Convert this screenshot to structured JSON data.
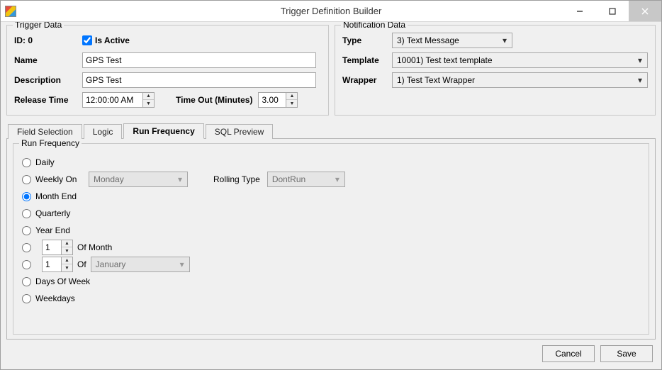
{
  "window": {
    "title": "Trigger Definition Builder"
  },
  "trigger_data": {
    "legend": "Trigger Data",
    "id_label": "ID: 0",
    "is_active_label": "Is Active",
    "is_active_checked": true,
    "name_label": "Name",
    "name_value": "GPS Test",
    "description_label": "Description",
    "description_value": "GPS Test",
    "release_time_label": "Release Time",
    "release_time_value": "12:00:00 AM",
    "time_out_label": "Time Out (Minutes)",
    "time_out_value": "3.00"
  },
  "notification_data": {
    "legend": "Notification Data",
    "type_label": "Type",
    "type_value": "3) Text Message",
    "template_label": "Template",
    "template_value": "10001) Test text template",
    "wrapper_label": "Wrapper",
    "wrapper_value": "1) Test Text Wrapper"
  },
  "tabs": {
    "field_selection": "Field Selection",
    "logic": "Logic",
    "run_frequency": "Run Frequency",
    "sql_preview": "SQL Preview"
  },
  "run_frequency": {
    "legend": "Run Frequency",
    "daily": "Daily",
    "weekly_on": "Weekly On",
    "weekly_day": "Monday",
    "rolling_type_label": "Rolling Type",
    "rolling_type_value": "DontRun",
    "month_end": "Month End",
    "quarterly": "Quarterly",
    "year_end": "Year End",
    "of_month_value": "1",
    "of_month_label": "Of Month",
    "of_monthname_value": "1",
    "of_label": "Of",
    "of_monthname_month": "January",
    "days_of_week": "Days Of Week",
    "weekdays": "Weekdays",
    "selected": "month_end"
  },
  "buttons": {
    "cancel": "Cancel",
    "save": "Save"
  }
}
